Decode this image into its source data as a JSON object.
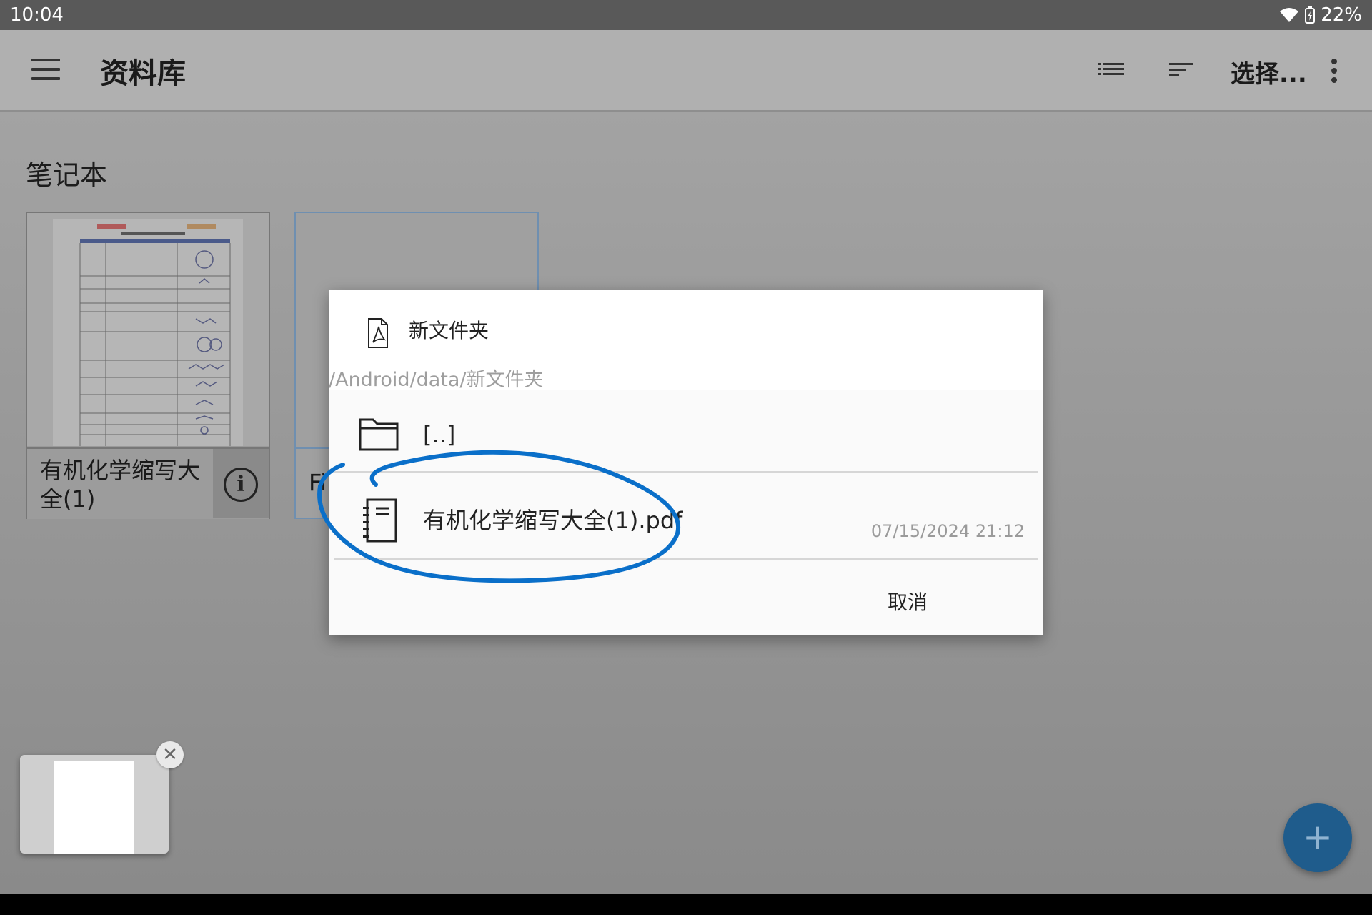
{
  "status_bar": {
    "time": "10:04",
    "battery": "22%",
    "icons": [
      "wifi-icon",
      "battery-charging-icon"
    ]
  },
  "app_bar": {
    "title": "资料库",
    "select_label": "选择...",
    "icons": [
      "menu-icon",
      "list-view-icon",
      "sort-icon",
      "more-vert-icon"
    ]
  },
  "library": {
    "section_title": "笔记本",
    "notebooks": [
      {
        "name": "有机化学缩写大全(1)"
      },
      {
        "name": "Fi"
      }
    ]
  },
  "dialog": {
    "title": "新文件夹",
    "path": "/Android/data/新文件夹",
    "parent_entry": "[..]",
    "files": [
      {
        "name": "有机化学缩写大全(1).pdf",
        "date": "07/15/2024 21:12"
      }
    ],
    "cancel_label": "取消"
  },
  "fab": {
    "symbol": "+"
  },
  "recents": {
    "close_symbol": "✕"
  },
  "colors": {
    "annotation_stroke": "#0a6fc9",
    "fab": "#1f5c8c",
    "scrim": "#9c9c9c"
  }
}
